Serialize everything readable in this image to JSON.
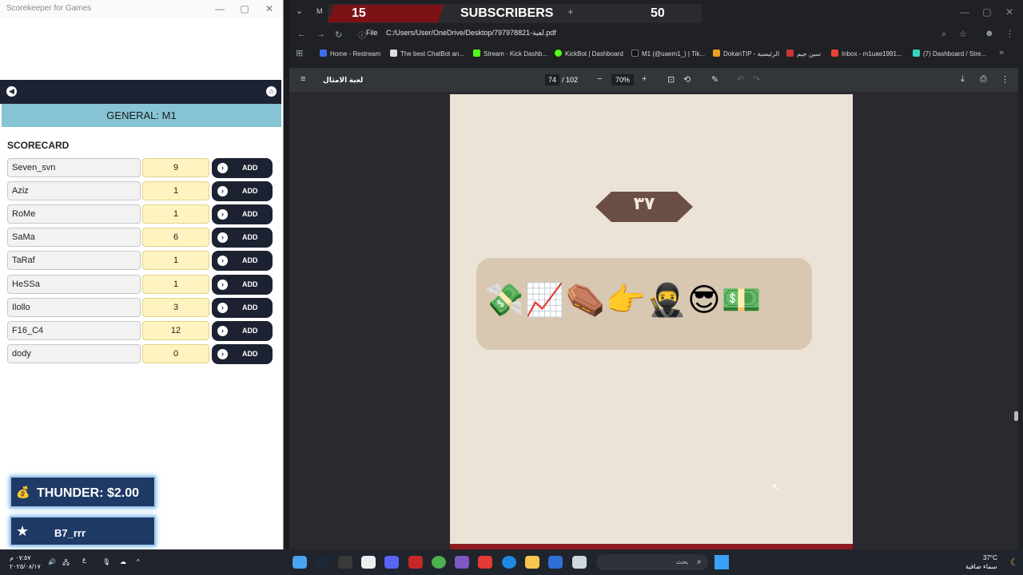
{
  "left_window": {
    "title": "Scorekeeper for Games",
    "controls": [
      "—",
      "▢",
      "✕"
    ],
    "general_title": "GENERAL: M1",
    "scorecard_title": "SCORECARD",
    "add_label": "ADD",
    "players": [
      {
        "name": "Seven_svn",
        "score": "9"
      },
      {
        "name": "Aziz",
        "score": "1"
      },
      {
        "name": "RoMe",
        "score": "1"
      },
      {
        "name": "SaMa",
        "score": "6"
      },
      {
        "name": "TaRaf",
        "score": "1"
      },
      {
        "name": "HeSSa",
        "score": "1"
      },
      {
        "name": "Ilollo",
        "score": "3"
      },
      {
        "name": "F16_C4",
        "score": "12"
      },
      {
        "name": "dody",
        "score": "0"
      }
    ]
  },
  "overlay": {
    "alert_text": "THUNDER: $2.00",
    "follower_text": "B7_rrr",
    "subscriber_left": "15",
    "subscriber_label": "SUBSCRIBERS",
    "subscriber_right": "50"
  },
  "browser": {
    "tab_label": "M",
    "url_scheme": "File",
    "url": "C:/Users/User/OneDrive/Desktop/797978821-لعبة.pdf",
    "bookmarks": [
      "Home - Restream",
      "The best ChatBot an...",
      "Stream - Kick Dashb...",
      "KickBot | Dashboard",
      "M1 (@uaem1_) | Tik...",
      "DokanTIP - الرئيسية",
      "سين جيم",
      "Inbox - m1uae1991...",
      "(7) Dashboard / Stre..."
    ],
    "pdf_title": "لعبة الامثال",
    "page_current": "74",
    "page_total": "/ 102",
    "zoom": "70%",
    "page_number_badge": "٣٧",
    "emojis": "💸📈⚰️👉🥷😎💵"
  },
  "taskbar": {
    "time": "٠٧:٥٧ م",
    "date": "٢٠٢٥/٠٨/١٧",
    "lang": "ع",
    "search_placeholder": "بحث",
    "temperature": "37°C",
    "weather": "سماء صافية"
  }
}
